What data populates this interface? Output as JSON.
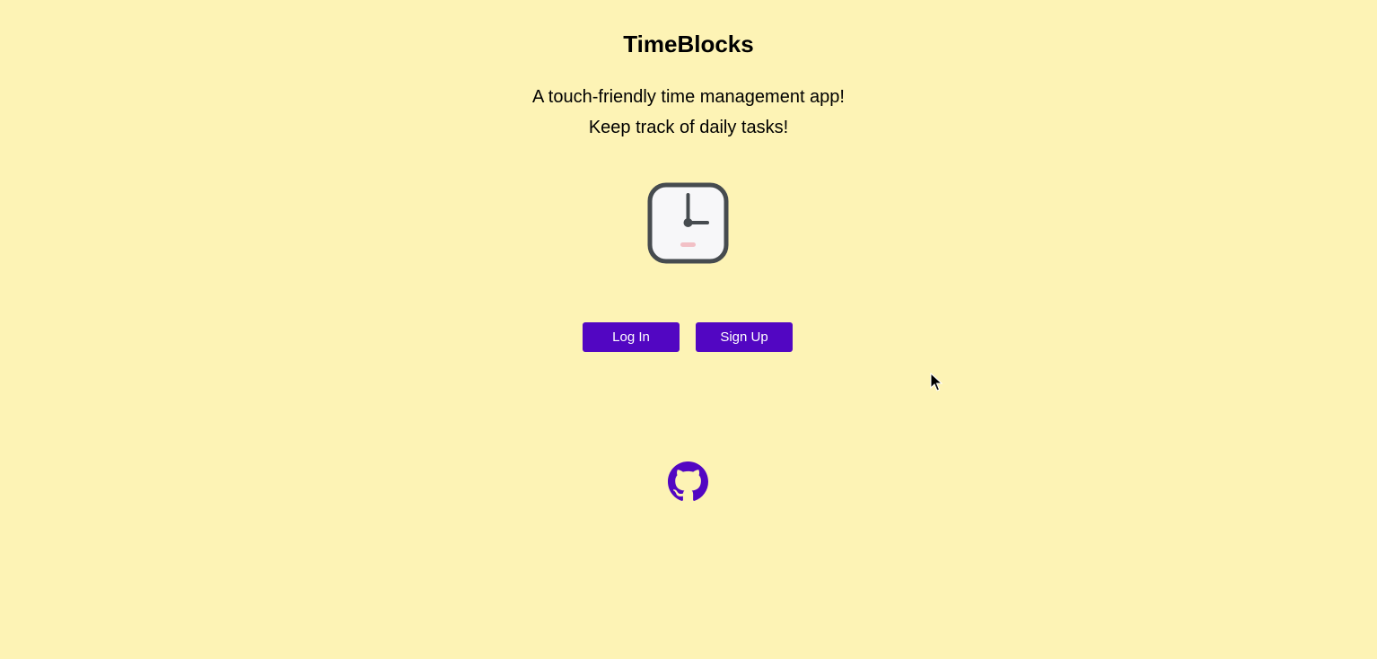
{
  "app": {
    "title": "TimeBlocks",
    "tagline_line1": "A touch-friendly time management app!",
    "tagline_line2": "Keep track of daily tasks!"
  },
  "logo": {
    "icon": "clock-icon"
  },
  "actions": {
    "login_label": "Log In",
    "signup_label": "Sign Up"
  },
  "footer": {
    "link_icon": "github-icon"
  },
  "colors": {
    "background": "#fdf3b5",
    "accent": "#5206c2",
    "clock_frame": "#464b4f",
    "clock_face": "#f7f7f9",
    "clock_mark": "#f2c0c6"
  }
}
